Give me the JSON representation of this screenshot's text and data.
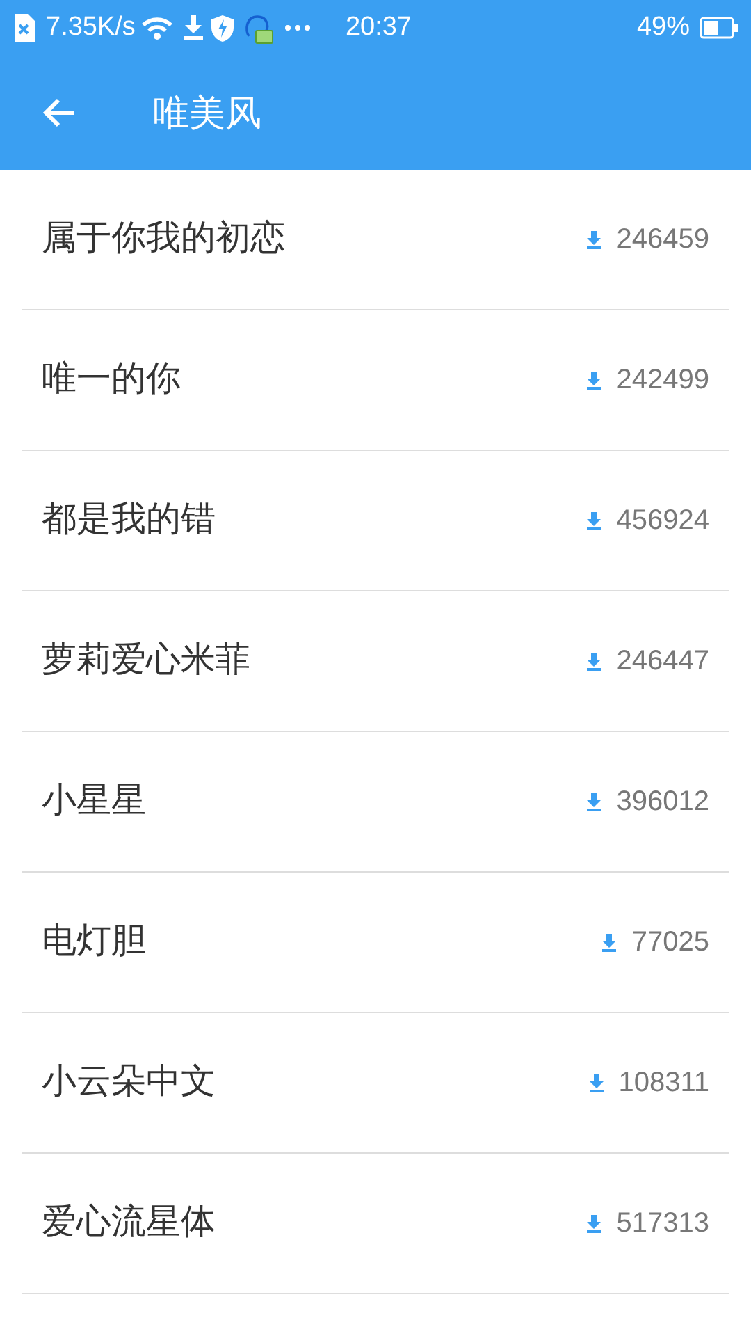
{
  "status_bar": {
    "network_speed": "7.35K/s",
    "time": "20:37",
    "battery": "49%"
  },
  "app_bar": {
    "title": "唯美风"
  },
  "fonts": [
    {
      "name": "属于你我的初恋",
      "downloads": "246459"
    },
    {
      "name": "唯一的你",
      "downloads": "242499"
    },
    {
      "name": "都是我的错",
      "downloads": "456924"
    },
    {
      "name": "萝莉爱心米菲",
      "downloads": "246447"
    },
    {
      "name": "小星星",
      "downloads": "396012"
    },
    {
      "name": "电灯胆",
      "downloads": "77025"
    },
    {
      "name": "小云朵中文",
      "downloads": "108311"
    },
    {
      "name": "爱心流星体",
      "downloads": "517313"
    }
  ]
}
